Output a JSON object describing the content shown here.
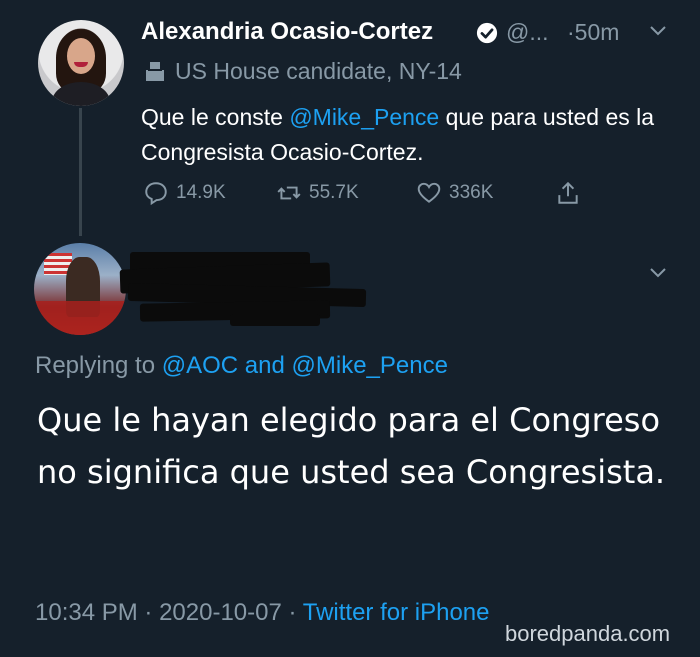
{
  "original_tweet": {
    "author_name": "Alexandria Ocasio-Cortez",
    "handle": "@...",
    "time": "·50m",
    "label": "US House candidate, NY-14",
    "text_before": "Que le conste ",
    "mention": "@Mike_Pence",
    "text_after": " que para usted es la Congresista Ocasio-Cortez.",
    "replies": "14.9K",
    "retweets": "55.7K",
    "likes": "336K"
  },
  "reply_tweet": {
    "replying_prefix": "Replying to ",
    "mention1": "@AOC",
    "and_word": " and ",
    "mention2": "@Mike_Pence",
    "text": "Que le hayan elegido para el Congreso no significa que usted sea Congresista.",
    "time": "10:34 PM",
    "sep1": " · ",
    "date": "2020-10-07",
    "sep2": " · ",
    "source": "Twitter for iPhone"
  },
  "watermark": "boredpanda.com",
  "colors": {
    "background": "#15202b",
    "muted": "#8899a6",
    "link": "#1da1f2",
    "text": "#ffffff"
  },
  "icons": [
    "verified-badge-icon",
    "chevron-down-icon",
    "ballot-box-icon",
    "reply-icon",
    "retweet-icon",
    "like-icon",
    "share-icon"
  ]
}
